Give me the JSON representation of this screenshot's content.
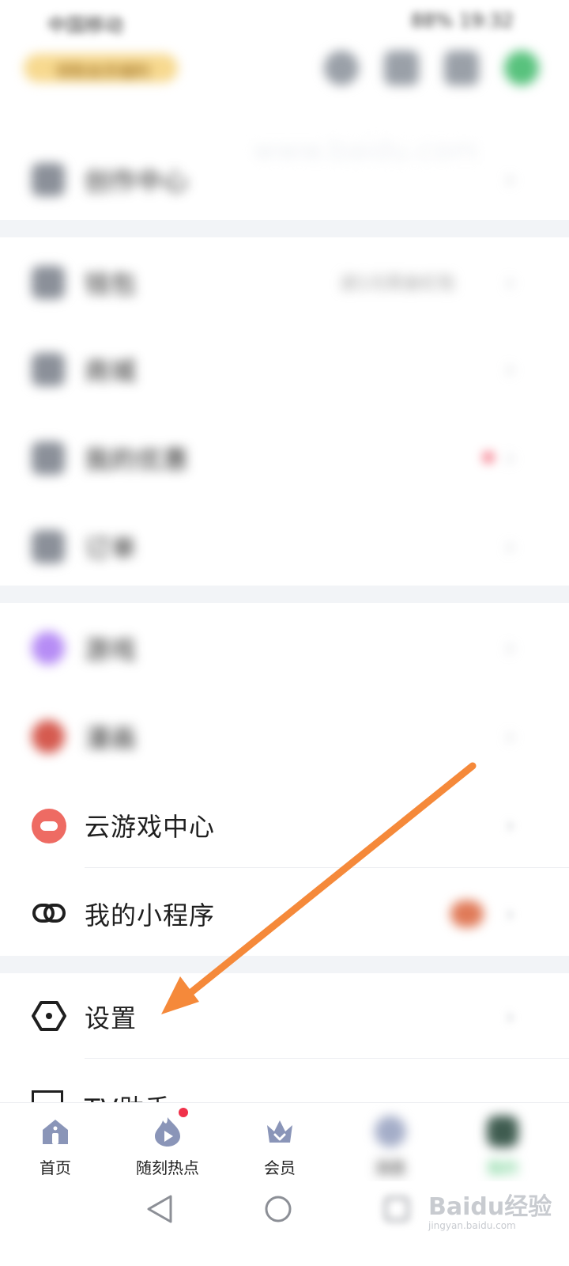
{
  "status_bar": {
    "left_text": "中国移动",
    "right_text": "88% 19:32"
  },
  "top_bar": {
    "promo_text": "领取会员福利"
  },
  "ghost_text": "www.baidu.com",
  "rows": [
    {
      "label": "创作中心",
      "blurred": true
    },
    {
      "label": "钱包",
      "blurred": true,
      "extra": "送1元现金红包"
    },
    {
      "label": "商城",
      "blurred": true
    },
    {
      "label": "我的优惠",
      "blurred": true
    },
    {
      "label": "订单",
      "blurred": true
    },
    {
      "label": "游戏",
      "blurred": true
    },
    {
      "label": "漫画",
      "blurred": true
    },
    {
      "label": "云游戏中心",
      "blurred": false
    },
    {
      "label": "我的小程序",
      "blurred": false
    },
    {
      "label": "设置",
      "blurred": false
    },
    {
      "label": "TV助手",
      "blurred": false
    }
  ],
  "bottom_nav": [
    {
      "label": "首页",
      "icon": "home-icon"
    },
    {
      "label": "随刻热点",
      "icon": "fire-play-icon"
    },
    {
      "label": "会员",
      "icon": "crown-icon"
    },
    {
      "label": "消息",
      "icon": "message-icon"
    },
    {
      "label": "我的",
      "icon": "profile-icon"
    }
  ],
  "watermark": {
    "main": "Baidu经验",
    "sub": "jingyan.baidu.com"
  },
  "colors": {
    "arrow": "#f5893a",
    "accent_nav": "#8a95b8",
    "red_dot": "#f0314a"
  }
}
